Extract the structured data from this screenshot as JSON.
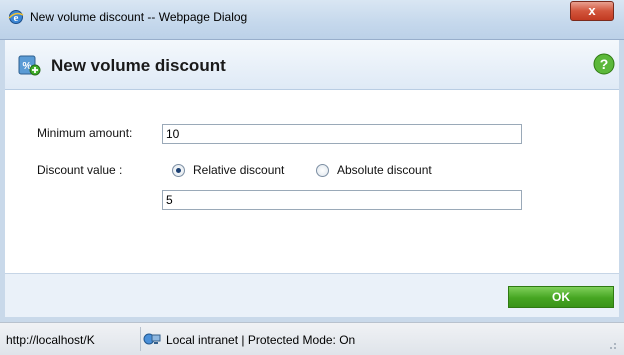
{
  "window": {
    "title": "New volume discount -- Webpage Dialog",
    "close_label": "x"
  },
  "dialog": {
    "title": "New volume discount"
  },
  "form": {
    "min_amount_label": "Minimum amount:",
    "min_amount_value": "10",
    "discount_value_label": "Discount value :",
    "relative_label": "Relative discount",
    "absolute_label": "Absolute discount",
    "selected_option": "Relative discount",
    "discount_value": "5"
  },
  "footer": {
    "ok_label": "OK"
  },
  "statusbar": {
    "url": "http://localhost/K",
    "zone": "Local intranet | Protected Mode: On"
  },
  "icons": {
    "browser": "ie-icon",
    "dialog": "discount-icon",
    "help": "help-icon",
    "zone": "intranet-icon"
  },
  "colors": {
    "ok_button": "#46a522",
    "close_button": "#d2553c",
    "header_bg": "#dfeaf6"
  }
}
